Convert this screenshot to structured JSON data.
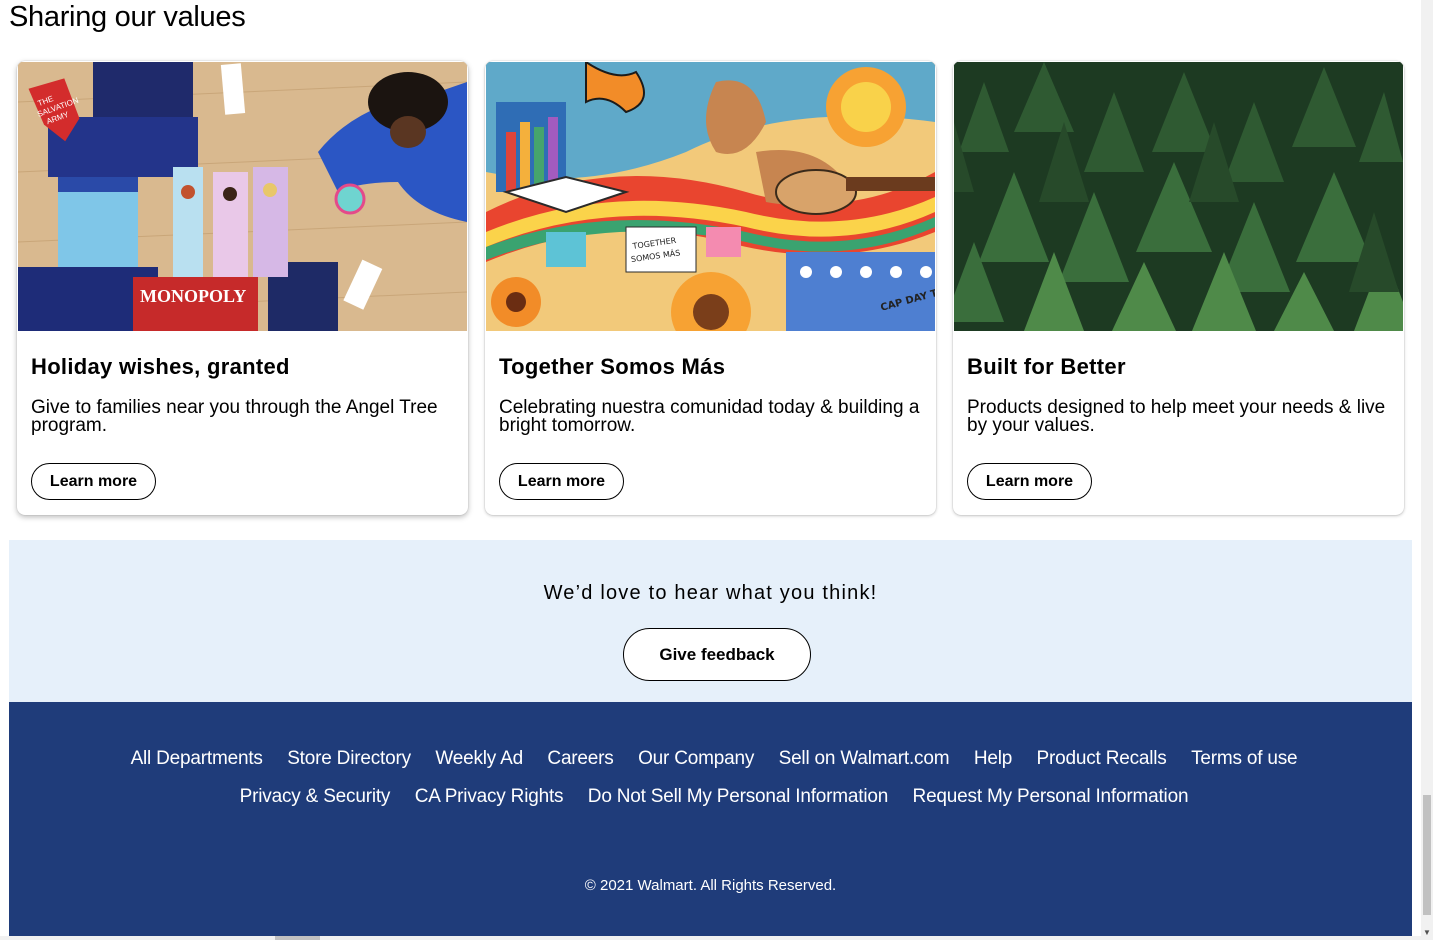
{
  "section": {
    "title": "Sharing our values"
  },
  "cards": [
    {
      "title": "Holiday wishes, granted",
      "description": "Give to families near you through the Angel Tree program.",
      "button": "Learn more",
      "image": "toys-gifts-salvation-army",
      "image_text": {
        "badge_line1": "THE",
        "badge_line2": "SALVATION",
        "badge_line3": "ARMY",
        "game": "MONOPOLY"
      }
    },
    {
      "title": "Together Somos Más",
      "description": "Celebrating nuestra comunidad today & building a bright tomorrow.",
      "button": "Learn more",
      "image": "colorful-hispanic-heritage-illustration",
      "image_text": {
        "banner_line1": "TOGETHER",
        "banner_line2": "SOMOS MÁS",
        "signature": "CAP DAY TON"
      }
    },
    {
      "title": "Built for Better",
      "description": "Products designed to help meet your needs & live by your values.",
      "button": "Learn more",
      "image": "pine-forest-aerial"
    }
  ],
  "feedback": {
    "text": "We’d love to hear what you think!",
    "button": "Give feedback"
  },
  "footer": {
    "links": [
      "All Departments",
      "Store Directory",
      "Weekly Ad",
      "Careers",
      "Our Company",
      "Sell on Walmart.com",
      "Help",
      "Product Recalls",
      "Terms of use",
      "Privacy & Security",
      "CA Privacy Rights",
      "Do Not Sell My Personal Information",
      "Request My Personal Information"
    ],
    "copyright": "© 2021 Walmart. All Rights Reserved."
  },
  "colors": {
    "footer_bg": "#1f3c7a",
    "feedback_bg": "#e6f0fa",
    "card_bg": "#ffffff"
  }
}
